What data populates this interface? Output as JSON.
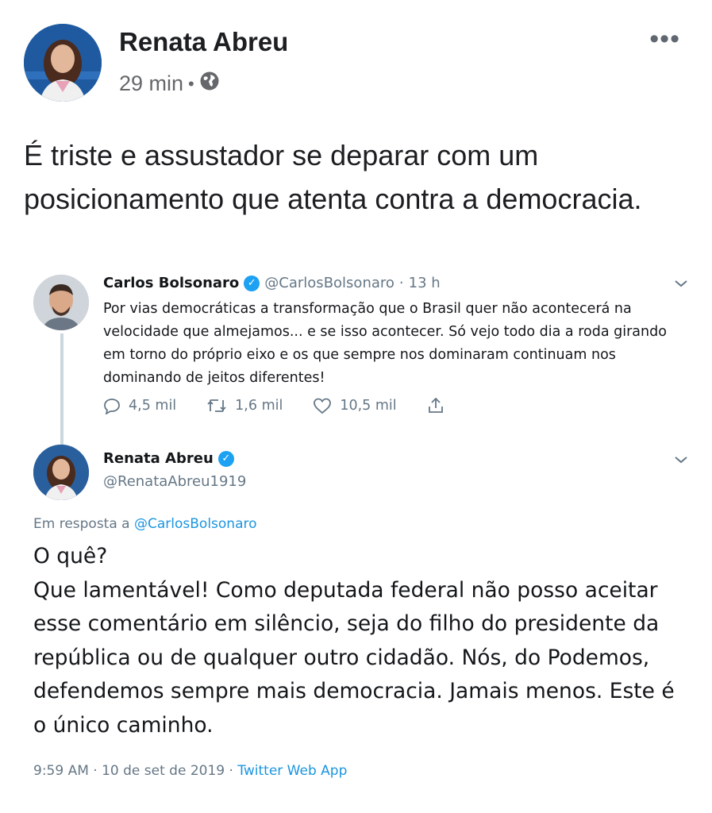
{
  "post": {
    "author": "Renata Abreu",
    "time": "29 min",
    "separator": "•",
    "text": "É triste e assustador se deparar com um posicionamento que atenta contra a democracia.",
    "more_icon": "more-options-icon",
    "privacy_icon": "globe-icon"
  },
  "tweet1": {
    "name": "Carlos Bolsonaro",
    "handle": "@CarlosBolsonaro",
    "dot": "·",
    "time": "13 h",
    "text": "Por vias democráticas a transformação que o Brasil quer não acontecerá na velocidade que almejamos... e se isso acontecer. Só vejo todo dia a roda girando em torno do próprio eixo e os que sempre nos dominaram continuam nos dominando de jeitos diferentes!",
    "replies": "4,5 mil",
    "retweets": "1,6 mil",
    "likes": "10,5 mil"
  },
  "tweet2": {
    "name": "Renata Abreu",
    "handle": "@RenataAbreu1919",
    "reply_prefix": "Em resposta a",
    "reply_to": "@CarlosBolsonaro",
    "text": "O quê?\nQue lamentável! Como deputada federal não posso aceitar esse comentário em silêncio, seja do filho do presidente da república ou de qualquer outro cidadão. Nós, do Podemos, defendemos sempre mais democracia. Jamais menos. Este é o único caminho.",
    "timestamp": "9:59 AM · 10 de set de 2019 ·",
    "app": "Twitter Web App"
  },
  "colors": {
    "twitter_blue": "#1da1f2",
    "link_blue": "#1b95e0",
    "grey": "#657786",
    "fb_grey": "#65676b"
  }
}
